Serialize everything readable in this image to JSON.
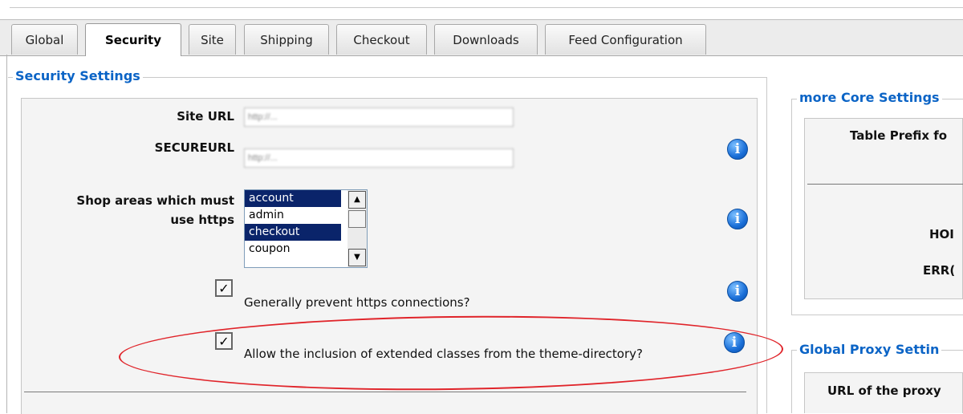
{
  "tabs": [
    {
      "label": "Global"
    },
    {
      "label": "Security",
      "active": true
    },
    {
      "label": "Site"
    },
    {
      "label": "Shipping"
    },
    {
      "label": "Checkout"
    },
    {
      "label": "Downloads"
    },
    {
      "label": "Feed Configuration"
    }
  ],
  "security": {
    "legend": "Security Settings",
    "site_url_label": "Site URL",
    "site_url_value": "http://...",
    "secure_url_label": "SECUREURL",
    "secure_url_value": "http://...",
    "shop_areas_label_1": "Shop areas which must",
    "shop_areas_label_2": "use https",
    "shop_areas_options": [
      {
        "label": "account",
        "selected": true
      },
      {
        "label": "admin",
        "selected": false
      },
      {
        "label": "checkout",
        "selected": true
      },
      {
        "label": "coupon",
        "selected": false
      }
    ],
    "prevent_https_label": "Generally prevent https connections?",
    "prevent_https_checked": true,
    "extended_classes_label": "Allow the inclusion of extended classes from the theme-directory?",
    "extended_classes_checked": true
  },
  "core": {
    "legend": "more Core Settings",
    "table_prefix_label": "Table Prefix fo",
    "hom_label": "HOI",
    "err_label": "ERR("
  },
  "proxy": {
    "legend": "Global Proxy Settin",
    "url_label": "URL of the proxy"
  },
  "icons": {
    "info": "info-icon",
    "checkmark": "checkmark-icon",
    "scroll_up": "arrow-up-icon",
    "scroll_down": "arrow-down-icon"
  },
  "colors": {
    "legend": "#0b64c6",
    "highlight_ellipse": "#e0242a",
    "selected_option": "#0a246a"
  }
}
